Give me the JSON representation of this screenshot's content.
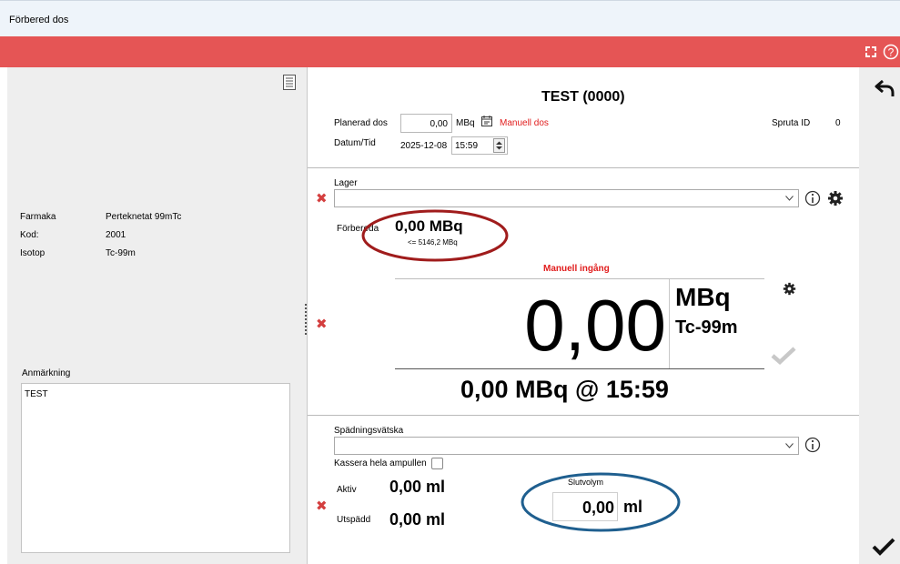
{
  "window": {
    "title": "Förbered dos"
  },
  "left": {
    "info_rows": [
      {
        "label": "Farmaka",
        "value": "Perteknetat 99mTc"
      },
      {
        "label": "Kod:",
        "value": "2001"
      },
      {
        "label": "Isotop",
        "value": "Tc-99m"
      }
    ],
    "remark_label": "Anmärkning",
    "remark_text": "TEST"
  },
  "header": {
    "title": "TEST (0000)",
    "planned_label": "Planerad dos",
    "planned_value": "0,00",
    "planned_unit": "MBq",
    "manual_label": "Manuell dos",
    "syringe_label": "Spruta ID",
    "syringe_value": "0",
    "datetime_label": "Datum/Tid",
    "date_value": "2025-12-08",
    "time_value": "15:59"
  },
  "lager": {
    "label": "Lager",
    "prepared_label": "Förbereda",
    "prepared_value": "0,00 MBq",
    "prepared_limit": "<= 5146,2 MBq"
  },
  "manual_input": {
    "title": "Manuell ingång",
    "value": "0,00",
    "unit": "MBq",
    "isotope": "Tc-99m",
    "summary": "0,00 MBq @ 15:59"
  },
  "dilution": {
    "label": "Spädningsvätska",
    "discard_label": "Kassera hela ampullen",
    "active_label": "Aktiv",
    "active_value": "0,00 ml",
    "diluted_label": "Utspädd",
    "diluted_value": "0,00 ml",
    "final_volume_label": "Slutvolym",
    "final_volume_value": "0,00",
    "final_volume_unit": "ml"
  },
  "annotations": {
    "color": "#a01c1c",
    "color2": "#1f5f8f"
  },
  "colors": {
    "header_bar": "#e55555",
    "title_bar": "#eef4fa",
    "panel": "#eeeeee",
    "warning_text": "#e11d1d"
  }
}
